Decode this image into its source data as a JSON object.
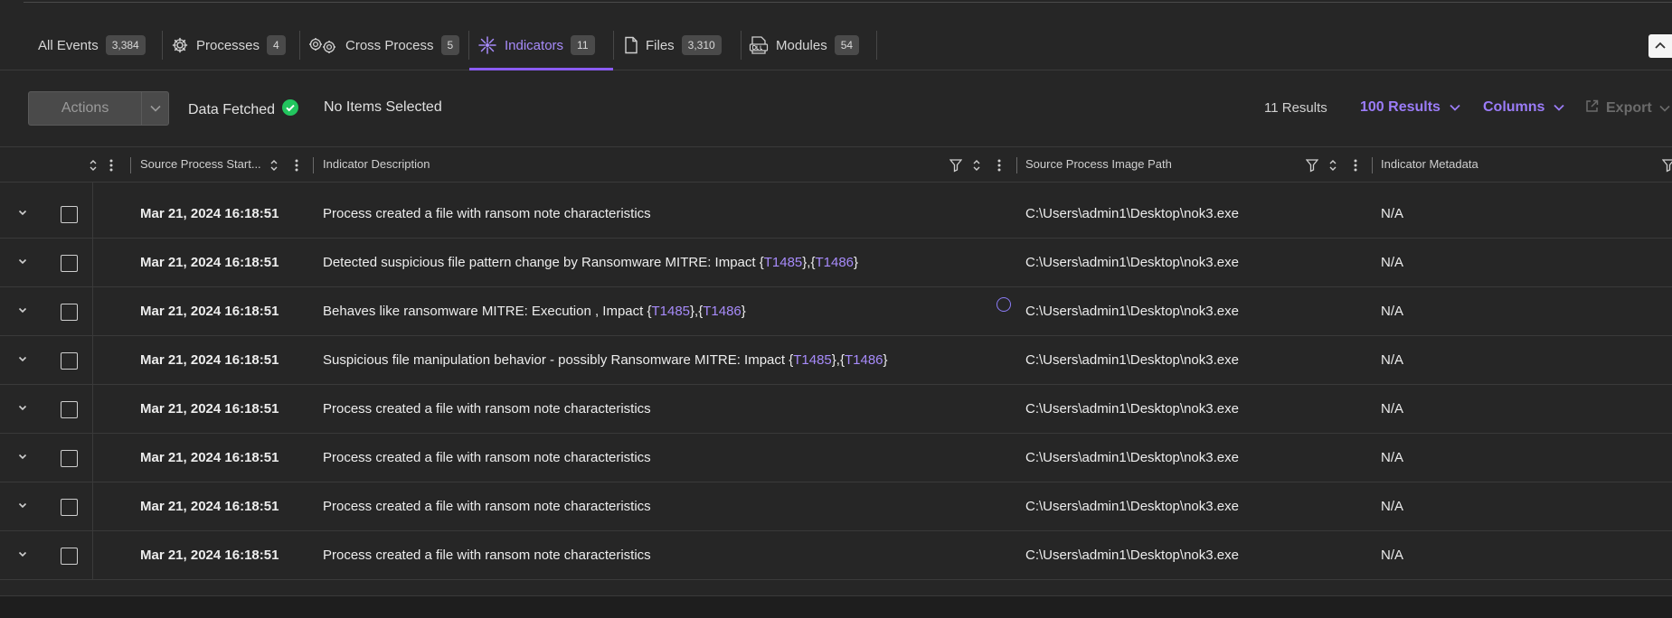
{
  "tabs": [
    {
      "label": "All Events",
      "count": "3,384",
      "icon": "none"
    },
    {
      "label": "Processes",
      "count": "4",
      "icon": "gear-icon"
    },
    {
      "label": "Cross Process",
      "count": "5",
      "icon": "double-gear-icon"
    },
    {
      "label": "Indicators",
      "count": "11",
      "icon": "spark-icon",
      "active": true
    },
    {
      "label": "Files",
      "count": "3,310",
      "icon": "file-icon"
    },
    {
      "label": "Modules",
      "count": "54",
      "icon": "dll-icon"
    }
  ],
  "toolbar": {
    "actions_label": "Actions",
    "fetched_label": "Data Fetched",
    "selection_label": "No Items Selected",
    "results_label": "11 Results",
    "page_size_label": "100 Results",
    "columns_label": "Columns",
    "export_label": "Export"
  },
  "columns": {
    "start": "Source Process Start...",
    "description": "Indicator Description",
    "image_path": "Source Process Image Path",
    "metadata": "Indicator Metadata"
  },
  "rows": [
    {
      "time": "Mar 21, 2024 16:18:51",
      "desc_pre": "Process created a file with ransom note characteristics",
      "path": "C:\\Users\\admin1\\Desktop\\nok3.exe",
      "meta": "N/A"
    },
    {
      "time": "Mar 21, 2024 16:18:51",
      "desc_pre": "Detected suspicious file pattern change by Ransomware MITRE: Impact {",
      "link1": "T1485",
      "mid": "},{",
      "link2": "T1486",
      "post": "}",
      "path": "C:\\Users\\admin1\\Desktop\\nok3.exe",
      "meta": "N/A"
    },
    {
      "time": "Mar 21, 2024 16:18:51",
      "desc_pre": "Behaves like ransomware MITRE: Execution , Impact {",
      "link1": "T1485",
      "mid": "},{",
      "link2": "T1486",
      "post": "}",
      "path": "C:\\Users\\admin1\\Desktop\\nok3.exe",
      "meta": "N/A"
    },
    {
      "time": "Mar 21, 2024 16:18:51",
      "desc_pre": "Suspicious file manipulation behavior - possibly Ransomware MITRE: Impact {",
      "link1": "T1485",
      "mid": "},{",
      "link2": "T1486",
      "post": "}",
      "path": "C:\\Users\\admin1\\Desktop\\nok3.exe",
      "meta": "N/A"
    },
    {
      "time": "Mar 21, 2024 16:18:51",
      "desc_pre": "Process created a file with ransom note characteristics",
      "path": "C:\\Users\\admin1\\Desktop\\nok3.exe",
      "meta": "N/A"
    },
    {
      "time": "Mar 21, 2024 16:18:51",
      "desc_pre": "Process created a file with ransom note characteristics",
      "path": "C:\\Users\\admin1\\Desktop\\nok3.exe",
      "meta": "N/A"
    },
    {
      "time": "Mar 21, 2024 16:18:51",
      "desc_pre": "Process created a file with ransom note characteristics",
      "path": "C:\\Users\\admin1\\Desktop\\nok3.exe",
      "meta": "N/A"
    },
    {
      "time": "Mar 21, 2024 16:18:51",
      "desc_pre": "Process created a file with ransom note characteristics",
      "path": "C:\\Users\\admin1\\Desktop\\nok3.exe",
      "meta": "N/A"
    }
  ],
  "colors": {
    "accent": "#8b5cf6",
    "link": "#a78bfa",
    "success": "#22c55e",
    "background": "#262626"
  }
}
